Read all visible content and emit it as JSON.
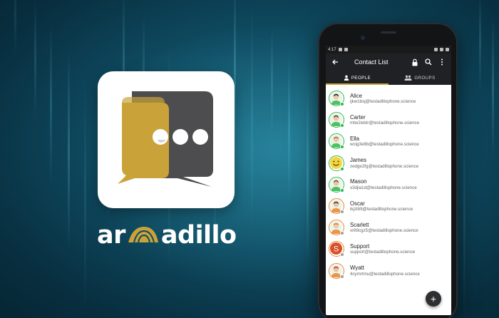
{
  "colors": {
    "brand_gold": "#c9a33a",
    "brand_dark": "#4d4d4f",
    "online_green": "#2fb84a",
    "ring_green": "#2fb84a",
    "ring_orange": "#e8852a",
    "background": "#0f4a60"
  },
  "brand": {
    "name": "armadillo"
  },
  "phone": {
    "status_bar": {
      "time": "4:17"
    },
    "app_bar": {
      "title": "Contact List",
      "icons": [
        "back-arrow-icon",
        "lock-icon",
        "search-icon",
        "more-vert-icon"
      ]
    },
    "tabs": [
      {
        "label": "PEOPLE",
        "icon": "person-icon",
        "active": true
      },
      {
        "label": "GROUPS",
        "icon": "group-icon",
        "active": false
      }
    ],
    "contacts": [
      {
        "name": "Alice",
        "email": "ijkw1bsj@testadillophone.science",
        "ring": "#2fb84a",
        "skin": "#f2c9a2",
        "hair": "#3b2a20",
        "online": true
      },
      {
        "name": "Carter",
        "email": "mtw2wtdr@testadillophone.science",
        "ring": "#2fb84a",
        "skin": "#f0c49a",
        "hair": "#6b4a2a",
        "online": true
      },
      {
        "name": "Ella",
        "email": "wcig3e8b@testadillophone.science",
        "ring": "#2fb84a",
        "skin": "#f2c9a2",
        "hair": "#c8702f",
        "online": true
      },
      {
        "name": "James",
        "email": "zedge2fg@testadillophone.science",
        "ring": "#2fb84a",
        "skin": "#f7d53a",
        "hair": "#f7d53a",
        "online": true
      },
      {
        "name": "Mason",
        "email": "x3djia1d@testadillophone.science",
        "ring": "#2fb84a",
        "skin": "#f0c49a",
        "hair": "#8a5a2a",
        "online": true
      },
      {
        "name": "Oscar",
        "email": "ikjztb9@testadillophone.science",
        "ring": "#e8852a",
        "skin": "#f0c49a",
        "hair": "#5a3a22",
        "online": false
      },
      {
        "name": "Scarlett",
        "email": "xr89cgz5@testadillophone.science",
        "ring": "#e8852a",
        "skin": "#f2c9a2",
        "hair": "#d7892e",
        "online": false
      },
      {
        "name": "Support",
        "email": "support@testadillophone.science",
        "ring": "#e8852a",
        "skin": "#d6502a",
        "hair": "#d6502a",
        "online": false,
        "letter": "S"
      },
      {
        "name": "Wyatt",
        "email": "4cymrtmu@testadillophone.science",
        "ring": "#e8852a",
        "skin": "#f0c49a",
        "hair": "#c5402a",
        "online": false
      }
    ],
    "fab": {
      "label": "+",
      "icon": "add-icon"
    }
  }
}
